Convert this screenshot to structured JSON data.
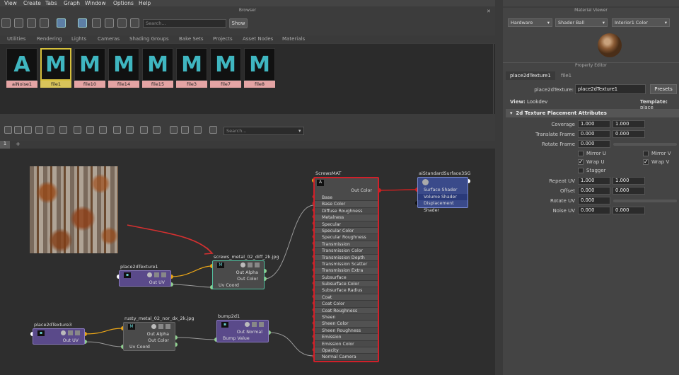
{
  "menubar": {
    "items": [
      "View",
      "Create",
      "Tabs",
      "Graph",
      "Window",
      "Options",
      "Help"
    ]
  },
  "browser": {
    "title": "Browser",
    "search_placeholder": "Search...",
    "show_label": "Show",
    "tabs": [
      "Utilities",
      "Rendering",
      "Lights",
      "Cameras",
      "Shading Groups",
      "Bake Sets",
      "Projects",
      "Asset Nodes",
      "Materials"
    ],
    "thumbnails": [
      {
        "glyph": "A",
        "label": "aiNoise1",
        "selected": false
      },
      {
        "glyph": "M",
        "label": "file1",
        "selected": true
      },
      {
        "glyph": "M",
        "label": "file10",
        "selected": false
      },
      {
        "glyph": "M",
        "label": "file14",
        "selected": false
      },
      {
        "glyph": "M",
        "label": "file15",
        "selected": false
      },
      {
        "glyph": "M",
        "label": "file3",
        "selected": false
      },
      {
        "glyph": "M",
        "label": "file7",
        "selected": false
      },
      {
        "glyph": "M",
        "label": "file8",
        "selected": false
      }
    ]
  },
  "node_editor": {
    "search_placeholder": "Search...",
    "tab_label": "1",
    "nodes": {
      "place1": {
        "title": "place2dTexture1",
        "out": "Out UV"
      },
      "file_screws": {
        "title": "screws_metal_02_diff_2k.jpg",
        "outs": [
          "Out Alpha",
          "Out Color"
        ],
        "in": "Uv Coord"
      },
      "place3": {
        "title": "place2dTexture3",
        "out": "Out UV"
      },
      "file_rusty": {
        "title": "rusty_metal_02_nor_dx_2k.jpg",
        "outs": [
          "Out Alpha",
          "Out Color"
        ],
        "in": "Uv Coord"
      },
      "bump": {
        "title": "bump2d1",
        "out": "Out Normal",
        "in": "Bump Value"
      },
      "mat": {
        "title": "ScrewsMAT",
        "out": "Out Color",
        "attrs": [
          "Base",
          "Base Color",
          "Diffuse Roughness",
          "Metalness",
          "Specular",
          "Specular Color",
          "Specular Roughness",
          "Transmission",
          "Transmission Color",
          "Transmission Depth",
          "Transmission Scatter",
          "Transmission Extra Roughness",
          "Subsurface",
          "Subsurface Color",
          "Subsurface Radius",
          "Coat",
          "Coat Color",
          "Coat Roughness",
          "Sheen",
          "Sheen Color",
          "Sheen Roughness",
          "Emission",
          "Emission Color",
          "Opacity",
          "Normal Camera"
        ]
      },
      "sg": {
        "title": "aiStandardSurface3SG",
        "attrs": [
          "Surface Shader",
          "Volume Shader",
          "Displacement Shader"
        ]
      }
    }
  },
  "material_viewer": {
    "title": "Material Viewer",
    "renderer": "Hardware",
    "shape": "Shader Ball",
    "env": "Interior1 Color"
  },
  "property_editor": {
    "title": "Property Editor",
    "tabs": [
      "place2dTexture1",
      "file1"
    ],
    "node_label": "place2dTexture:",
    "node_value": "place2dTexture1",
    "presets": "Presets",
    "view_label": "View:",
    "view_value": "Lookdev",
    "template_label": "Template:",
    "template_value": "place",
    "section": "2d Texture Placement Attributes",
    "coverage": {
      "label": "Coverage",
      "v1": "1.000",
      "v2": "1.000"
    },
    "translate": {
      "label": "Translate Frame",
      "v1": "0.000",
      "v2": "0.000"
    },
    "rotate_frame": {
      "label": "Rotate Frame",
      "v1": "0.000"
    },
    "mirror_u": "Mirror U",
    "mirror_v": "Mirror V",
    "wrap_u": "Wrap U",
    "wrap_v": "Wrap V",
    "stagger": "Stagger",
    "repeat": {
      "label": "Repeat UV",
      "v1": "1.000",
      "v2": "1.000"
    },
    "offset": {
      "label": "Offset",
      "v1": "0.000",
      "v2": "0.000"
    },
    "rotate_uv": {
      "label": "Rotate UV",
      "v1": "0.000"
    },
    "noise": {
      "label": "Noise UV",
      "v1": "0.000",
      "v2": "0.000"
    }
  }
}
